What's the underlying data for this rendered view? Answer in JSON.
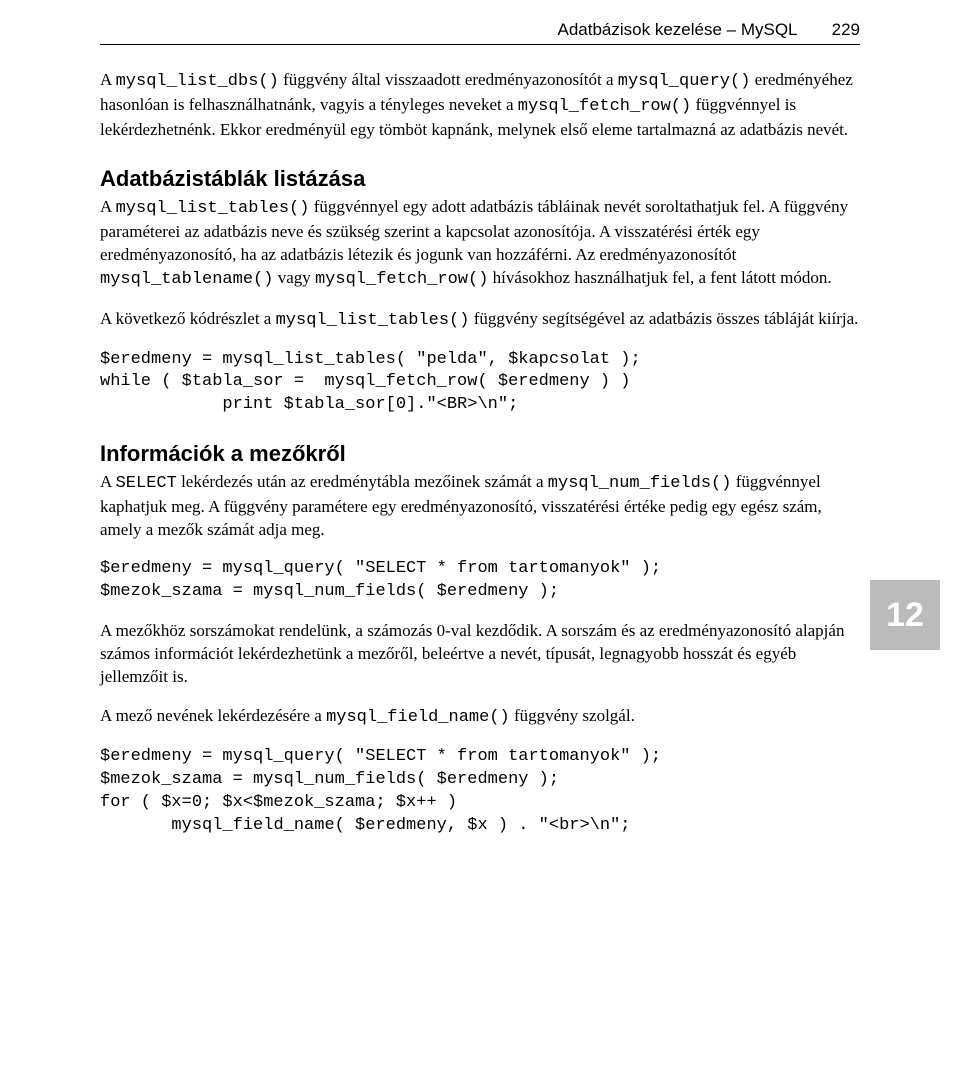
{
  "header": {
    "title": "Adatbázisok kezelése – MySQL",
    "page_number": "229"
  },
  "chapter_tab": "12",
  "paragraphs": {
    "p1_a": "A ",
    "p1_code1": "mysql_list_dbs()",
    "p1_b": " függvény által visszaadott eredményazonosítót a ",
    "p1_code2": "mysql_query()",
    "p1_c": " eredményéhez hasonlóan is felhasználhatnánk, vagyis a tényleges neveket a ",
    "p1_code3": "mysql_fetch_row()",
    "p1_d": " függvénnyel is lekérdezhetnénk. Ekkor eredményül egy tömböt kapnánk, melynek első eleme tartalmazná az adatbázis nevét."
  },
  "section1": {
    "heading": "Adatbázistáblák listázása",
    "p2_a": "A ",
    "p2_code1": "mysql_list_tables()",
    "p2_b": " függvénnyel egy adott adatbázis tábláinak nevét soroltathatjuk fel. A függvény paraméterei az adatbázis neve és szükség szerint a kapcsolat azonosítója. A visszatérési érték egy eredményazonosító, ha az adatbázis létezik és jogunk van hozzáférni. Az eredményazonosítót ",
    "p2_code2": "mysql_tablename()",
    "p2_c": " vagy ",
    "p2_code3": "mysql_fetch_row()",
    "p2_d": " hívásokhoz használhatjuk fel, a fent látott módon.",
    "p3_a": "A következő kódrészlet a ",
    "p3_code1": "mysql_list_tables()",
    "p3_b": " függvény segítségével az adatbázis összes tábláját kiírja.",
    "code1": "$eredmeny = mysql_list_tables( \"pelda\", $kapcsolat );\nwhile ( $tabla_sor =  mysql_fetch_row( $eredmeny ) )\n            print $tabla_sor[0].\"<BR>\\n\";"
  },
  "section2": {
    "heading": "Információk a mezőkről",
    "p4_a": "A ",
    "p4_code1": "SELECT",
    "p4_b": " lekérdezés után az eredménytábla mezőinek számát a ",
    "p4_code2": "mysql_num_fields()",
    "p4_c": " függvénnyel kaphatjuk meg. A függvény paramétere egy eredményazonosító, visszatérési értéke pedig egy egész szám, amely a mezők számát adja meg.",
    "code2": "$eredmeny = mysql_query( \"SELECT * from tartomanyok\" );\n$mezok_szama = mysql_num_fields( $eredmeny );",
    "p5": "A mezőkhöz sorszámokat rendelünk, a számozás 0-val kezdődik. A sorszám és az eredményazonosító alapján számos információt lekérdezhetünk a mezőről, beleértve a nevét, típusát, legnagyobb hosszát és egyéb jellemzőit is.",
    "p6_a": "A mező nevének lekérdezésére a ",
    "p6_code1": "mysql_field_name()",
    "p6_b": " függvény szolgál.",
    "code3": "$eredmeny = mysql_query( \"SELECT * from tartomanyok\" );\n$mezok_szama = mysql_num_fields( $eredmeny );\nfor ( $x=0; $x<$mezok_szama; $x++ )\n       mysql_field_name( $eredmeny, $x ) . \"<br>\\n\";"
  }
}
